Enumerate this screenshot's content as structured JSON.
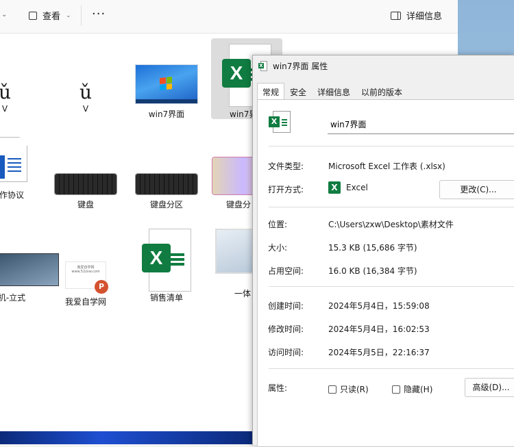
{
  "explorer": {
    "toolbar": {
      "view_label": "查看",
      "more_label": "···",
      "details_label": "详细信息"
    },
    "files": [
      {
        "label": "V",
        "glyph": "ǔ"
      },
      {
        "label": "V",
        "glyph": "ǔ"
      },
      {
        "label": "win7界面"
      },
      {
        "label": "win7界"
      },
      {
        "label": "作协议"
      },
      {
        "label": "键盘"
      },
      {
        "label": "键盘分区"
      },
      {
        "label": "键盘分"
      },
      {
        "label": "机-立式"
      },
      {
        "label": "我爱自学网",
        "thumb_text": "我爱自学网 www.52zxw.com"
      },
      {
        "label": "销售清单"
      },
      {
        "label": "一体"
      }
    ]
  },
  "dialog": {
    "title": "win7界面 属性",
    "tabs": [
      "常规",
      "安全",
      "详细信息",
      "以前的版本"
    ],
    "file_name": "win7界面",
    "rows": {
      "type": {
        "label": "文件类型:",
        "value": "Microsoft Excel 工作表 (.xlsx)"
      },
      "open_with": {
        "label": "打开方式:",
        "value": "Excel",
        "button": "更改(C)..."
      },
      "location": {
        "label": "位置:",
        "value": "C:\\Users\\zxw\\Desktop\\素材文件"
      },
      "size": {
        "label": "大小:",
        "value": "15.3 KB (15,686 字节)"
      },
      "disk_size": {
        "label": "占用空间:",
        "value": "16.0 KB (16,384 字节)"
      },
      "created": {
        "label": "创建时间:",
        "value": "2024年5月4日，15:59:08"
      },
      "modified": {
        "label": "修改时间:",
        "value": "2024年5月4日，16:02:53"
      },
      "accessed": {
        "label": "访问时间:",
        "value": "2024年5月5日，22:16:37"
      },
      "attributes": {
        "label": "属性:",
        "readonly": "只读(R)",
        "hidden": "隐藏(H)",
        "advanced": "高级(D)..."
      }
    }
  },
  "colors": {
    "excel_green": "#107c41",
    "word_blue": "#185abd",
    "ppt_orange": "#d35230"
  }
}
